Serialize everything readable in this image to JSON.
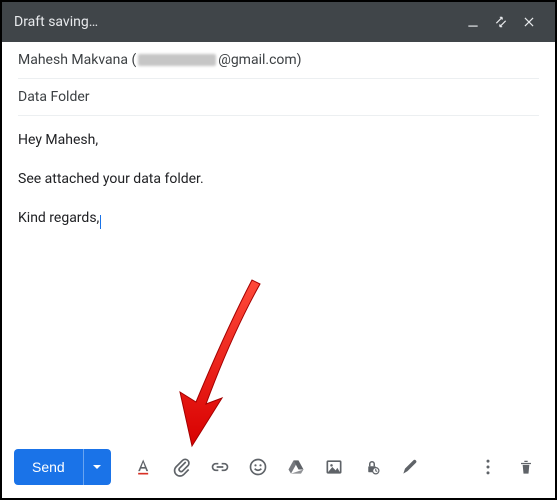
{
  "titlebar": {
    "title": "Draft saving…"
  },
  "to": {
    "name": "Mahesh Makvana",
    "domain": "@gmail.com"
  },
  "subject": "Data Folder",
  "body": {
    "greeting": "Hey Mahesh,",
    "line1": "See attached your data folder.",
    "signoff": "Kind regards,"
  },
  "toolbar": {
    "send": "Send"
  },
  "icons": {
    "minimize": "minimize-icon",
    "popout": "popout-icon",
    "close": "close-icon",
    "format": "format-text-icon",
    "attach": "paperclip-icon",
    "link": "link-icon",
    "emoji": "smiley-icon",
    "drive": "drive-icon",
    "photo": "photo-icon",
    "confidential": "confidential-icon",
    "pen": "pen-icon",
    "more": "more-menu-icon",
    "trash": "trash-icon"
  }
}
